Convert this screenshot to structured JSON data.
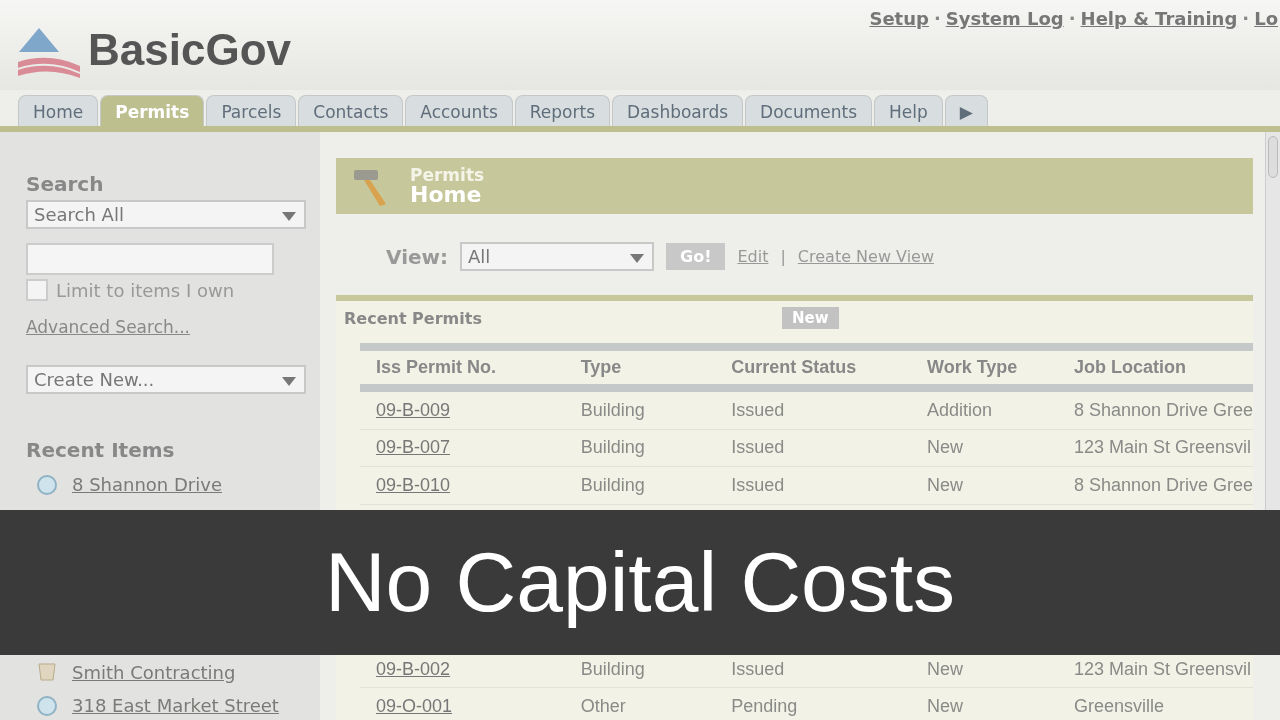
{
  "logo": {
    "text": "BasicGov"
  },
  "top_links": [
    "Setup",
    "System Log",
    "Help & Training",
    "Lo"
  ],
  "top_links_separator": "·",
  "tabs": [
    {
      "label": "Home",
      "selected": false
    },
    {
      "label": "Permits",
      "selected": true
    },
    {
      "label": "Parcels",
      "selected": false
    },
    {
      "label": "Contacts",
      "selected": false
    },
    {
      "label": "Accounts",
      "selected": false
    },
    {
      "label": "Reports",
      "selected": false
    },
    {
      "label": "Dashboards",
      "selected": false
    },
    {
      "label": "Documents",
      "selected": false
    },
    {
      "label": "Help",
      "selected": false
    },
    {
      "label": "▶",
      "selected": false
    }
  ],
  "sidebar": {
    "search_title": "Search",
    "search_scope": "Search All",
    "limit_label": "Limit to items I own",
    "limit_checked": false,
    "advanced_link": "Advanced Search...",
    "create_new": "Create New...",
    "recent_title": "Recent Items",
    "recent_items_above_caption": [
      {
        "label": "8 Shannon Drive",
        "kind": "parcel"
      }
    ],
    "recent_items_below_caption": [
      {
        "label": "Smith Contracting",
        "kind": "contact"
      },
      {
        "label": "318 East Market Street",
        "kind": "parcel"
      }
    ]
  },
  "header": {
    "title_top": "Permits",
    "title_bottom": "Home"
  },
  "view": {
    "label": "View:",
    "value": "All",
    "go": "Go!",
    "edit": "Edit",
    "separator": "|",
    "create": "Create New View"
  },
  "recent_permits": {
    "title": "Recent Permits",
    "new_button": "New",
    "columns": [
      "Iss Permit No.",
      "Type",
      "Current Status",
      "Work Type",
      "Job Location"
    ],
    "rows_above_caption": [
      [
        "09-B-009",
        "Building",
        "Issued",
        "Addition",
        "8 Shannon Drive Gree"
      ],
      [
        "09-B-007",
        "Building",
        "Issued",
        "New",
        "123 Main St Greensvil"
      ],
      [
        "09-B-010",
        "Building",
        "Issued",
        "New",
        "8 Shannon Drive Gree"
      ]
    ],
    "rows_below_caption": [
      [
        "09-B-002",
        "Building",
        "Issued",
        "New",
        "123 Main St Greensvil"
      ],
      [
        "09-O-001",
        "Other",
        "Pending",
        "New",
        "Greensville"
      ]
    ]
  },
  "caption": "No Capital Costs"
}
